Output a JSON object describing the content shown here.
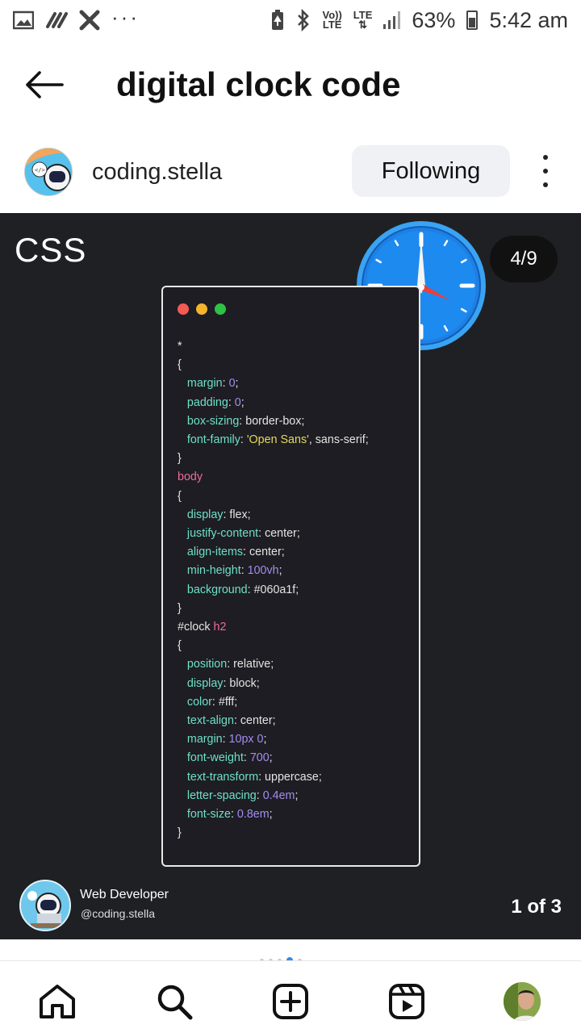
{
  "status_bar": {
    "battery": "63%",
    "time": "5:42 am",
    "network": "LTE",
    "volte": "Vo))",
    "volte_sub": "LTE",
    "dots": "···"
  },
  "header": {
    "title": "digital clock code"
  },
  "author": {
    "username": "coding.stella",
    "follow_label": "Following"
  },
  "post": {
    "label": "CSS",
    "counter": "4/9",
    "code_lines": [
      [
        {
          "c": "",
          "t": "*"
        }
      ],
      [
        {
          "c": "",
          "t": "{"
        }
      ],
      [
        {
          "c": "",
          "t": "   "
        },
        {
          "c": "p",
          "t": "margin"
        },
        {
          "c": "",
          "t": ": "
        },
        {
          "c": "n",
          "t": "0"
        },
        {
          "c": "",
          "t": ";"
        }
      ],
      [
        {
          "c": "",
          "t": "   "
        },
        {
          "c": "p",
          "t": "padding"
        },
        {
          "c": "",
          "t": ": "
        },
        {
          "c": "n",
          "t": "0"
        },
        {
          "c": "",
          "t": ";"
        }
      ],
      [
        {
          "c": "",
          "t": "   "
        },
        {
          "c": "p",
          "t": "box-sizing"
        },
        {
          "c": "",
          "t": ": border-box;"
        }
      ],
      [
        {
          "c": "",
          "t": "   "
        },
        {
          "c": "p",
          "t": "font-family"
        },
        {
          "c": "",
          "t": ": "
        },
        {
          "c": "s",
          "t": "'Open Sans'"
        },
        {
          "c": "",
          "t": ", sans-serif;"
        }
      ],
      [
        {
          "c": "",
          "t": "}"
        }
      ],
      [
        {
          "c": "t",
          "t": "body"
        }
      ],
      [
        {
          "c": "",
          "t": "{"
        }
      ],
      [
        {
          "c": "",
          "t": "   "
        },
        {
          "c": "p",
          "t": "display"
        },
        {
          "c": "",
          "t": ": flex;"
        }
      ],
      [
        {
          "c": "",
          "t": "   "
        },
        {
          "c": "p",
          "t": "justify-content"
        },
        {
          "c": "",
          "t": ": center;"
        }
      ],
      [
        {
          "c": "",
          "t": "   "
        },
        {
          "c": "p",
          "t": "align-items"
        },
        {
          "c": "",
          "t": ": center;"
        }
      ],
      [
        {
          "c": "",
          "t": "   "
        },
        {
          "c": "p",
          "t": "min-height"
        },
        {
          "c": "",
          "t": ": "
        },
        {
          "c": "n",
          "t": "100vh"
        },
        {
          "c": "",
          "t": ";"
        }
      ],
      [
        {
          "c": "",
          "t": "   "
        },
        {
          "c": "p",
          "t": "background"
        },
        {
          "c": "",
          "t": ": #060a1f;"
        }
      ],
      [
        {
          "c": "",
          "t": "}"
        }
      ],
      [
        {
          "c": "",
          "t": "#clock "
        },
        {
          "c": "t",
          "t": "h2"
        }
      ],
      [
        {
          "c": "",
          "t": "{"
        }
      ],
      [
        {
          "c": "",
          "t": "   "
        },
        {
          "c": "p",
          "t": "position"
        },
        {
          "c": "",
          "t": ": relative;"
        }
      ],
      [
        {
          "c": "",
          "t": "   "
        },
        {
          "c": "p",
          "t": "display"
        },
        {
          "c": "",
          "t": ": block;"
        }
      ],
      [
        {
          "c": "",
          "t": "   "
        },
        {
          "c": "p",
          "t": "color"
        },
        {
          "c": "",
          "t": ": #fff;"
        }
      ],
      [
        {
          "c": "",
          "t": "   "
        },
        {
          "c": "p",
          "t": "text-align"
        },
        {
          "c": "",
          "t": ": center;"
        }
      ],
      [
        {
          "c": "",
          "t": "   "
        },
        {
          "c": "p",
          "t": "margin"
        },
        {
          "c": "",
          "t": ": "
        },
        {
          "c": "n",
          "t": "10px 0"
        },
        {
          "c": "",
          "t": ";"
        }
      ],
      [
        {
          "c": "",
          "t": "   "
        },
        {
          "c": "p",
          "t": "font-weight"
        },
        {
          "c": "",
          "t": ": "
        },
        {
          "c": "n",
          "t": "700"
        },
        {
          "c": "",
          "t": ";"
        }
      ],
      [
        {
          "c": "",
          "t": "   "
        },
        {
          "c": "p",
          "t": "text-transform"
        },
        {
          "c": "",
          "t": ": uppercase;"
        }
      ],
      [
        {
          "c": "",
          "t": "   "
        },
        {
          "c": "p",
          "t": "letter-spacing"
        },
        {
          "c": "",
          "t": ": "
        },
        {
          "c": "n",
          "t": "0.4em"
        },
        {
          "c": "",
          "t": ";"
        }
      ],
      [
        {
          "c": "",
          "t": "   "
        },
        {
          "c": "p",
          "t": "font-size"
        },
        {
          "c": "",
          "t": ": "
        },
        {
          "c": "n",
          "t": "0.8em"
        },
        {
          "c": "",
          "t": ";"
        }
      ],
      [
        {
          "c": "",
          "t": "}"
        }
      ]
    ],
    "footer": {
      "role": "Web Developer",
      "handle": "@coding.stella",
      "page": "1 of 3"
    }
  },
  "colors": {
    "post_bg": "#1f2024",
    "accent_blue": "#2e8bf0",
    "code_property": "#6ee0c8",
    "code_number": "#a58cf0",
    "code_string": "#e6d95a",
    "code_tag": "#ef6aa0"
  },
  "nav": {
    "items": [
      "home-icon",
      "search-icon",
      "create-post-icon",
      "reels-icon",
      "profile-avatar"
    ]
  }
}
